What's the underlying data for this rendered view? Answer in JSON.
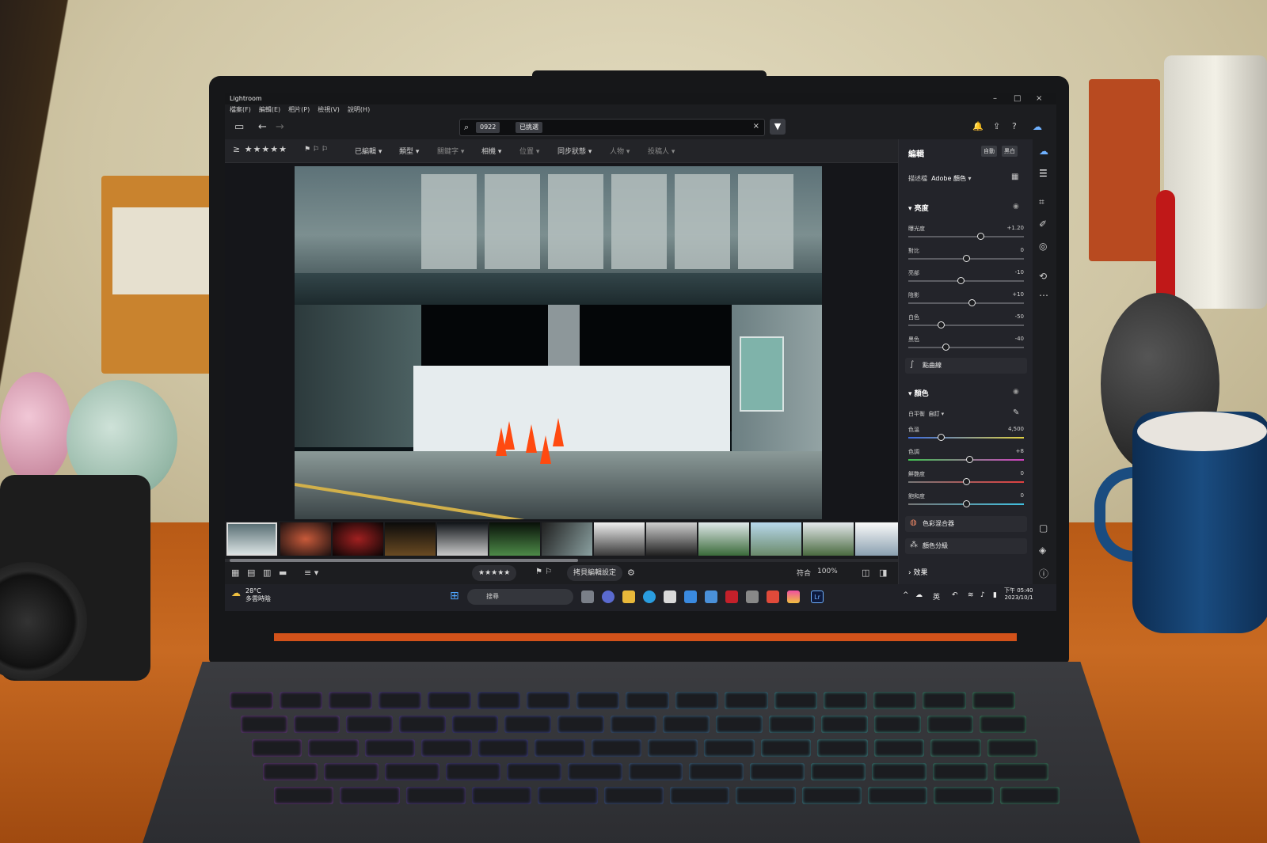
{
  "window": {
    "app_title": "Lightroom",
    "controls": [
      "–",
      "□",
      "×"
    ]
  },
  "menu": [
    "檔案(F)",
    "編輯(E)",
    "相片(P)",
    "檢視(V)",
    "說明(H)"
  ],
  "search": {
    "chip1": "0922",
    "chip2": "已挑選"
  },
  "filterbar": {
    "stars": "≥ ★★★★★",
    "items": [
      "已編輯",
      "類型",
      "關鍵字",
      "相機",
      "位置",
      "同步狀態",
      "人物",
      "投稿人"
    ]
  },
  "bottombar": {
    "rating": "★★★★★",
    "copy_settings": "拷貝編輯設定",
    "fit": "符合",
    "zoom": "100%"
  },
  "panel": {
    "header": "編輯",
    "auto_btn": "自動",
    "bw_btn": "黑白",
    "profile_label": "描述檔",
    "profile_value": "Adobe 顏色",
    "light_section": "亮度",
    "light_sliders": [
      {
        "label": "曝光度",
        "value": "+1.20",
        "pos": 0.62
      },
      {
        "label": "對比",
        "value": "0",
        "pos": 0.5
      },
      {
        "label": "亮部",
        "value": "-10",
        "pos": 0.45
      },
      {
        "label": "陰影",
        "value": "+10",
        "pos": 0.55
      },
      {
        "label": "白色",
        "value": "-50",
        "pos": 0.28
      },
      {
        "label": "黑色",
        "value": "-40",
        "pos": 0.32
      }
    ],
    "curve_tool": "點曲線",
    "color_section": "顏色",
    "wb_label": "白平衡",
    "wb_value": "自訂",
    "color_sliders": [
      {
        "label": "色溫",
        "value": "4,500",
        "pos": 0.28
      },
      {
        "label": "色調",
        "value": "+8",
        "pos": 0.53
      },
      {
        "label": "鮮艷度",
        "value": "0",
        "pos": 0.5
      },
      {
        "label": "飽和度",
        "value": "0",
        "pos": 0.5
      }
    ],
    "mixer_tool": "色彩混合器",
    "grading_tool": "顏色分級",
    "effects_section": "效果"
  },
  "taskbar": {
    "weather_temp": "28°C",
    "weather_desc": "多雲時陰",
    "search_placeholder": "搜尋",
    "lang": "英",
    "time": "下午 05:40",
    "date": "2023/10/1",
    "lr_label": "Lr"
  },
  "colors": {
    "accent_orange": "#ff4a10",
    "lr_blue": "#6fb1ff"
  }
}
